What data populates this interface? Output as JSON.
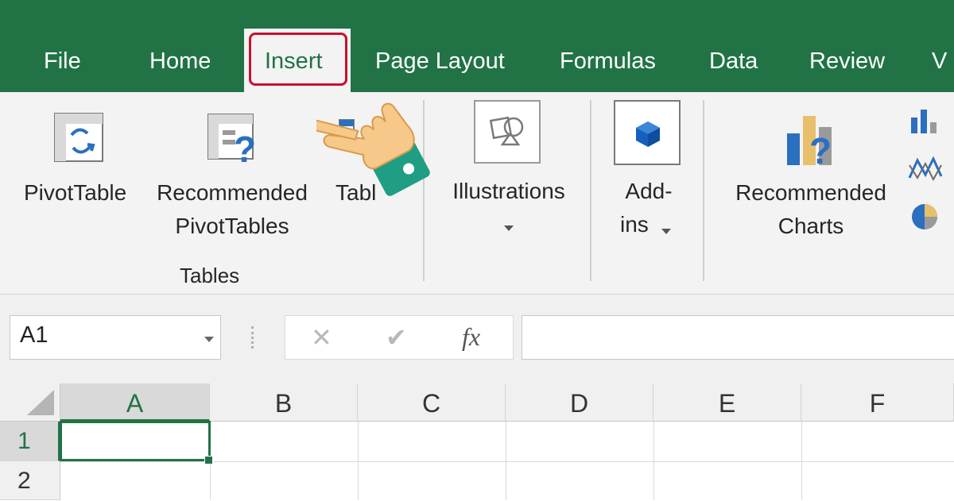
{
  "tabs": {
    "file": "File",
    "home": "Home",
    "insert": "Insert",
    "page_layout": "Page Layout",
    "formulas": "Formulas",
    "data": "Data",
    "review": "Review",
    "view_partial": "V"
  },
  "ribbon": {
    "pivottable": "PivotTable",
    "recommended_pivottables_1": "Recommended",
    "recommended_pivottables_2": "PivotTables",
    "table_partial": "Tabl",
    "tables_group": "Tables",
    "illustrations": "Illustrations",
    "addins_1": "Add-",
    "addins_2": "ins",
    "recommended_charts_1": "Recommended",
    "recommended_charts_2": "Charts"
  },
  "formula_bar": {
    "name_box": "A1",
    "cancel_glyph": "✕",
    "enter_glyph": "✔",
    "fx": "fx",
    "formula_value": ""
  },
  "grid": {
    "columns": [
      "A",
      "B",
      "C",
      "D",
      "E",
      "F"
    ],
    "rows": [
      "1",
      "2"
    ],
    "selected_cell": "A1"
  },
  "colors": {
    "excel_green": "#217346",
    "highlight_red": "#c8102e",
    "icon_blue": "#2b6fbf",
    "hand_skin": "#f6c98a",
    "cuff_teal": "#1f9e83"
  },
  "icons": [
    "pivottable-icon",
    "recommended-pivottables-icon",
    "illustrations-icon",
    "addins-icon",
    "recommended-charts-icon",
    "bar-chart-icon",
    "line-chart-icon",
    "pie-chart-icon",
    "pointing-hand-icon",
    "dropdown-arrow-icon"
  ]
}
